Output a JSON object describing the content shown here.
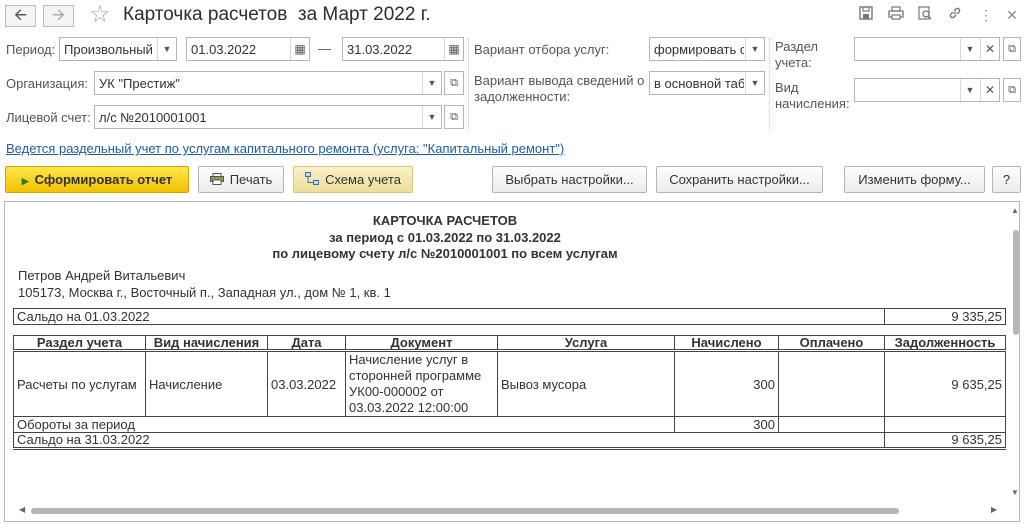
{
  "window": {
    "title": "Карточка расчетов  за Март 2022 г."
  },
  "form": {
    "period_label": "Период:",
    "period_type": "Произвольный",
    "date_from": "01.03.2022",
    "date_dash": "—",
    "date_to": "31.03.2022",
    "org_label": "Организация:",
    "org_value": "УК \"Престиж\"",
    "account_label": "Лицевой счет:",
    "account_value": "л/с №2010001001",
    "service_filter_label": "Вариант отбора услуг:",
    "service_filter_value": "формировать с",
    "debt_output_label_1": "Вариант вывода сведений о",
    "debt_output_label_2": "задолженности:",
    "debt_output_value": "в основной таб",
    "section_label_1": "Раздел",
    "section_label_2": "учета:",
    "section_value": "",
    "charge_label_1": "Вид",
    "charge_label_2": "начисления:",
    "charge_value": ""
  },
  "link_text": "Ведется раздельный учет по услугам капитального ремонта (услуга: \"Капитальный ремонт\")",
  "toolbar": {
    "generate": "Сформировать отчет",
    "print": "Печать",
    "schema": "Схема учета",
    "choose_settings": "Выбрать настройки...",
    "save_settings": "Сохранить настройки...",
    "change_form": "Изменить форму...",
    "help": "?"
  },
  "report": {
    "title": "КАРТОЧКА РАСЧЕТОВ",
    "subtitle": "за период с 01.03.2022 по 31.03.2022",
    "subtitle2": "по лицевому счету л/с №2010001001 по всем услугам",
    "person": "Петров Андрей Витальевич",
    "address": "105173, Москва г., Восточный п., Западная ул., дом № 1, кв. 1",
    "opening_label": "Сальдо на 01.03.2022",
    "opening_value": "9 335,25",
    "columns": [
      "Раздел учета",
      "Вид начисления",
      "Дата",
      "Документ",
      "Услуга",
      "Начислено",
      "Оплачено",
      "Задолженность"
    ],
    "row": {
      "section": "Расчеты по услугам",
      "charge_type": "Начисление",
      "date": "03.03.2022",
      "doc_1": "Начисление услуг в",
      "doc_2": "сторонней программе",
      "doc_3": "УК00-000002 от",
      "doc_4": "03.03.2022 12:00:00",
      "service": "Вывоз мусора",
      "charged": "300",
      "paid": "",
      "debt": "9 635,25"
    },
    "turnover_label": "Обороты за период",
    "turnover_charged": "300",
    "closing_label": "Сальдо на 31.03.2022",
    "closing_value": "9 635,25"
  }
}
